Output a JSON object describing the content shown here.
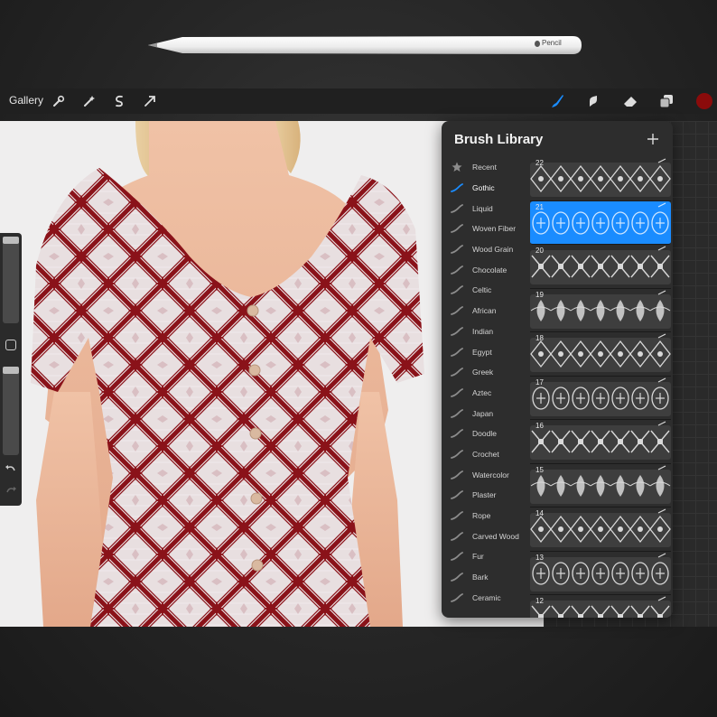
{
  "pencil": {
    "brand": "Pencil"
  },
  "toolbar": {
    "gallery_label": "Gallery",
    "left_icons": [
      "wrench-icon",
      "magic-wand-icon",
      "selection-s-icon",
      "transform-arrow-icon"
    ],
    "right_icons": [
      "brush-icon",
      "smudge-icon",
      "eraser-icon",
      "layers-icon"
    ],
    "accent_color": "#1a8cff",
    "current_color": "#8b0b0b"
  },
  "canvas": {
    "pattern_colors": {
      "base": "#e8dfe0",
      "primary": "#8a1219",
      "secondary": "#d9bfc3"
    }
  },
  "sidebar": {
    "undo_icon": "undo-icon",
    "redo_icon": "redo-icon",
    "size_level": 0.0,
    "opacity_level": 0.0
  },
  "brush_library": {
    "title": "Brush Library",
    "sets": [
      {
        "label": "Recent",
        "icon": "star-icon"
      },
      {
        "label": "Gothic",
        "icon": "brush-stroke-icon",
        "active": true
      },
      {
        "label": "Liquid",
        "icon": "brush-stroke-icon"
      },
      {
        "label": "Woven Fiber",
        "icon": "brush-stroke-icon"
      },
      {
        "label": "Wood Grain",
        "icon": "brush-stroke-icon"
      },
      {
        "label": "Chocolate",
        "icon": "brush-stroke-icon"
      },
      {
        "label": "Celtic",
        "icon": "brush-stroke-icon"
      },
      {
        "label": "African",
        "icon": "brush-stroke-icon"
      },
      {
        "label": "Indian",
        "icon": "brush-stroke-icon"
      },
      {
        "label": "Egypt",
        "icon": "brush-stroke-icon"
      },
      {
        "label": "Greek",
        "icon": "brush-stroke-icon"
      },
      {
        "label": "Aztec",
        "icon": "brush-stroke-icon"
      },
      {
        "label": "Japan",
        "icon": "brush-stroke-icon"
      },
      {
        "label": "Doodle",
        "icon": "brush-stroke-icon"
      },
      {
        "label": "Crochet",
        "icon": "brush-stroke-icon"
      },
      {
        "label": "Watercolor",
        "icon": "brush-stroke-icon"
      },
      {
        "label": "Plaster",
        "icon": "brush-stroke-icon"
      },
      {
        "label": "Rope",
        "icon": "brush-stroke-icon"
      },
      {
        "label": "Carved Wood",
        "icon": "brush-stroke-icon"
      },
      {
        "label": "Fur",
        "icon": "brush-stroke-icon"
      },
      {
        "label": "Bark",
        "icon": "brush-stroke-icon"
      },
      {
        "label": "Ceramic",
        "icon": "brush-stroke-icon"
      }
    ],
    "brushes": [
      {
        "number": "22"
      },
      {
        "number": "21",
        "selected": true
      },
      {
        "number": "20"
      },
      {
        "number": "19"
      },
      {
        "number": "18"
      },
      {
        "number": "17"
      },
      {
        "number": "16"
      },
      {
        "number": "15"
      },
      {
        "number": "14"
      },
      {
        "number": "13"
      },
      {
        "number": "12"
      }
    ]
  }
}
